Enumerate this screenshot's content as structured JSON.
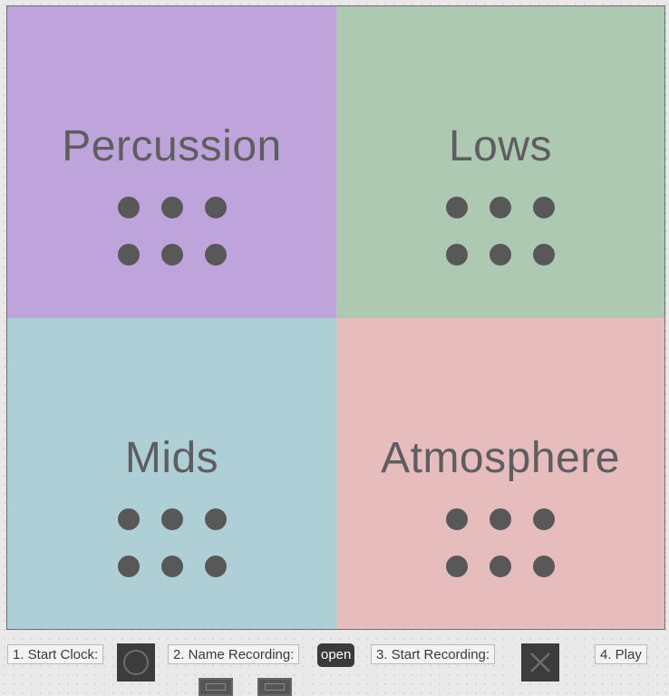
{
  "quadrants": [
    {
      "title": "Percussion",
      "color": "#bfa4dc"
    },
    {
      "title": "Lows",
      "color": "#aec9b1"
    },
    {
      "title": "Mids",
      "color": "#aecfd5"
    },
    {
      "title": "Atmosphere",
      "color": "#e6bcbd"
    }
  ],
  "controls": {
    "start_clock_label": "1. Start Clock:",
    "clock_toggle_icon": "circle-icon",
    "name_recording_label": "2. Name Recording:",
    "open_button_label": "open",
    "start_recording_label": "3. Start Recording:",
    "record_toggle_icon": "x-icon",
    "play_label": "4. Play"
  }
}
